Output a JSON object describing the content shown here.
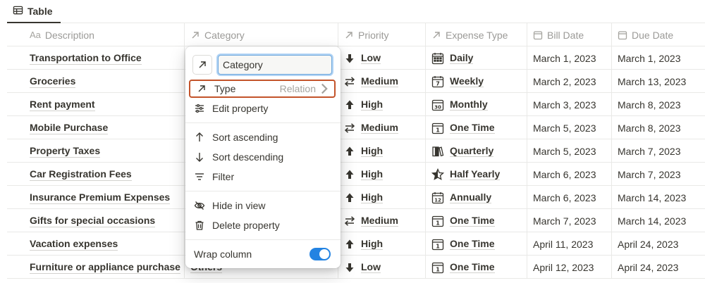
{
  "view_tab": {
    "label": "Table"
  },
  "columns": [
    {
      "key": "description",
      "label": "Description",
      "prefix": "Aa"
    },
    {
      "key": "category",
      "label": "Category"
    },
    {
      "key": "priority",
      "label": "Priority"
    },
    {
      "key": "expense_type",
      "label": "Expense Type"
    },
    {
      "key": "bill_date",
      "label": "Bill Date"
    },
    {
      "key": "due_date",
      "label": "Due Date"
    }
  ],
  "rows": [
    {
      "description": "Transportation to Office",
      "category": "",
      "priority": "Low",
      "priority_icon": "arrow-down-icon",
      "expense_type": "Daily",
      "expense_icon": "calendar-grid-icon",
      "bill_date": "March 1, 2023",
      "due_date": "March 1, 2023"
    },
    {
      "description": "Groceries",
      "category": "",
      "priority": "Medium",
      "priority_icon": "swap-arrows-icon",
      "expense_type": "Weekly",
      "expense_icon": "calendar-7-icon",
      "bill_date": "March 2, 2023",
      "due_date": "March 13, 2023"
    },
    {
      "description": "Rent payment",
      "category": "",
      "priority": "High",
      "priority_icon": "arrow-up-icon",
      "expense_type": "Monthly",
      "expense_icon": "calendar-30-icon",
      "bill_date": "March 3, 2023",
      "due_date": "March 8, 2023"
    },
    {
      "description": "Mobile Purchase",
      "category": "",
      "priority": "Medium",
      "priority_icon": "swap-arrows-icon",
      "expense_type": "One Time",
      "expense_icon": "calendar-1-icon",
      "bill_date": "March 5, 2023",
      "due_date": "March 8, 2023"
    },
    {
      "description": "Property Taxes",
      "category": "",
      "priority": "High",
      "priority_icon": "arrow-up-icon",
      "expense_type": "Quarterly",
      "expense_icon": "books-icon",
      "bill_date": "March 5, 2023",
      "due_date": "March 7, 2023"
    },
    {
      "description": "Car Registration Fees",
      "category": "",
      "priority": "High",
      "priority_icon": "arrow-up-icon",
      "expense_type": "Half Yearly",
      "expense_icon": "half-star-icon",
      "bill_date": "March 6, 2023",
      "due_date": "March 7, 2023"
    },
    {
      "description": "Insurance Premium Expenses",
      "category": "",
      "priority": "High",
      "priority_icon": "arrow-up-icon",
      "expense_type": "Annually",
      "expense_icon": "calendar-12-icon",
      "bill_date": "March 6, 2023",
      "due_date": "March 14, 2023"
    },
    {
      "description": "Gifts for special occasions",
      "category": "",
      "priority": "Medium",
      "priority_icon": "swap-arrows-icon",
      "expense_type": "One Time",
      "expense_icon": "calendar-1-icon",
      "bill_date": "March 7, 2023",
      "due_date": "March 14, 2023"
    },
    {
      "description": "Vacation expenses",
      "category": "",
      "priority": "High",
      "priority_icon": "arrow-up-icon",
      "expense_type": "One Time",
      "expense_icon": "calendar-1-icon",
      "bill_date": "April 11, 2023",
      "due_date": "April 24, 2023"
    },
    {
      "description": "Furniture or appliance purchase",
      "category": "Others",
      "priority": "Low",
      "priority_icon": "arrow-down-icon",
      "expense_type": "One Time",
      "expense_icon": "calendar-1-icon",
      "bill_date": "April 12, 2023",
      "due_date": "April 24, 2023"
    }
  ],
  "menu": {
    "name_value": "Category",
    "type_label": "Type",
    "type_value": "Relation",
    "edit_property": "Edit property",
    "sort_ascending": "Sort ascending",
    "sort_descending": "Sort descending",
    "filter": "Filter",
    "hide_in_view": "Hide in view",
    "delete_property": "Delete property",
    "wrap_column": "Wrap column",
    "wrap_column_on": true
  },
  "colors": {
    "accent": "#2383e2",
    "highlight_border": "#c3532a",
    "text": "#37352f",
    "muted": "#9b9a97"
  }
}
